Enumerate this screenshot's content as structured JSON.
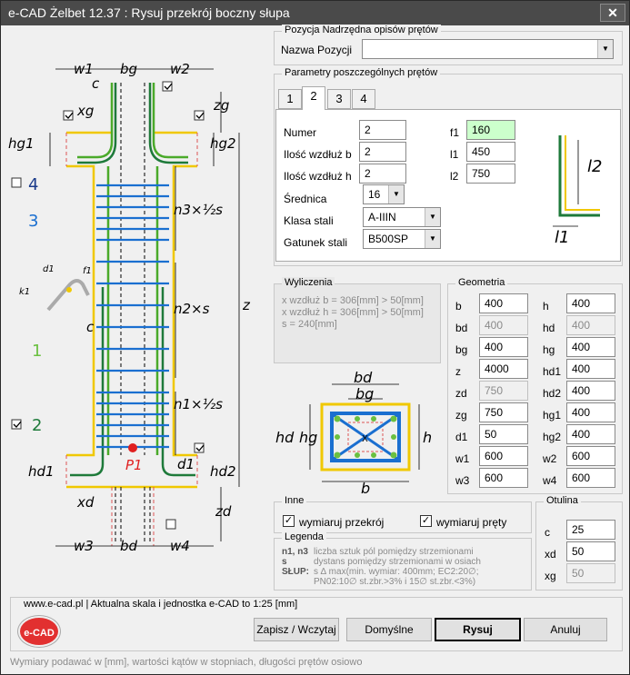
{
  "window": {
    "title": "e-CAD Żelbet 12.37 : Rysuj przekrój boczny słupa",
    "close_glyph": "✕"
  },
  "top_group": {
    "title": "Pozycja Nadrzędna opisów prętów",
    "name_label": "Nazwa Pozycji",
    "name_value": ""
  },
  "params_group": {
    "title": "Parametry poszczególnych prętów"
  },
  "tabs": [
    "1",
    "2",
    "3",
    "4"
  ],
  "active_tab": 1,
  "bar_params": {
    "numer_label": "Numer",
    "numer": "2",
    "ilosc_b_label": "Ilość wzdłuż b",
    "ilosc_b": "2",
    "ilosc_h_label": "Ilość wzdłuż h",
    "ilosc_h": "2",
    "srednica_label": "Średnica",
    "srednica": "16",
    "klasa_label": "Klasa stali",
    "klasa": "A-IIIN",
    "gatunek_label": "Gatunek stali",
    "gatunek": "B500SP",
    "f1_label": "f1",
    "f1": "160",
    "l1_label": "l1",
    "l1": "450",
    "l2_label": "l2",
    "l2": "750"
  },
  "bar_sketch": {
    "l1": "l1",
    "l2": "l2"
  },
  "calc_group": {
    "title": "Wyliczenia",
    "lines": [
      "x wzdłuż b = 306[mm] > 50[mm]",
      "x wzdłuż h = 306[mm] > 50[mm]",
      "s = 240[mm]"
    ]
  },
  "geometry_group": {
    "title": "Geometria",
    "left": [
      {
        "label": "b",
        "value": "400",
        "disabled": false
      },
      {
        "label": "bd",
        "value": "400",
        "disabled": true
      },
      {
        "label": "bg",
        "value": "400",
        "disabled": false
      },
      {
        "label": "z",
        "value": "4000",
        "disabled": false
      },
      {
        "label": "zd",
        "value": "750",
        "disabled": true
      },
      {
        "label": "zg",
        "value": "750",
        "disabled": false
      },
      {
        "label": "d1",
        "value": "50",
        "disabled": false
      },
      {
        "label": "w1",
        "value": "600",
        "disabled": false
      },
      {
        "label": "w3",
        "value": "600",
        "disabled": false
      }
    ],
    "right": [
      {
        "label": "h",
        "value": "400",
        "disabled": false
      },
      {
        "label": "hd",
        "value": "400",
        "disabled": true
      },
      {
        "label": "hg",
        "value": "400",
        "disabled": false
      },
      {
        "label": "hd1",
        "value": "400",
        "disabled": false
      },
      {
        "label": "hd2",
        "value": "400",
        "disabled": false
      },
      {
        "label": "hg1",
        "value": "400",
        "disabled": false
      },
      {
        "label": "hg2",
        "value": "400",
        "disabled": false
      },
      {
        "label": "w2",
        "value": "600",
        "disabled": false
      },
      {
        "label": "w4",
        "value": "600",
        "disabled": false
      }
    ]
  },
  "section_sketch": {
    "bd": "bd",
    "bg": "bg",
    "hd": "hd",
    "hg": "hg",
    "h": "h",
    "b": "b",
    "x": "X"
  },
  "inne_group": {
    "title": "Inne",
    "chk1": "wymiaruj przekrój",
    "chk2": "wymiaruj pręty",
    "chk1_checked": true,
    "chk2_checked": true
  },
  "otulina_group": {
    "title": "Otulina",
    "c_label": "c",
    "c": "25",
    "xd_label": "xd",
    "xd": "50",
    "xg_label": "xg",
    "xg": "50"
  },
  "legend_group": {
    "title": "Legenda",
    "rows": [
      {
        "key": "n1, n3",
        "text": "liczba sztuk pól pomiędzy strzemionami"
      },
      {
        "key": "s",
        "text": "dystans pomiędzy strzemionami w osiach"
      },
      {
        "key": "SŁUP:",
        "text": "s ∆ max(min. wymiar: 400mm; EC2:20∅;"
      },
      {
        "key": "",
        "text": "PN02:10∅ st.zbr.>3% i 15∅ st.zbr.<3%)"
      }
    ]
  },
  "footer": {
    "info": "www.e-cad.pl | Aktualna skala i jednostka e-CAD to 1:25 [mm]",
    "logo": "e-CAD",
    "status": "Wymiary podawać w [mm], wartości kątów w stopniach, długości prętów osiowo"
  },
  "buttons": {
    "save": "Zapisz / Wczytaj",
    "default": "Domyślne",
    "draw": "Rysuj",
    "cancel": "Anuluj"
  },
  "drawing": {
    "w1": "w1",
    "bg": "bg",
    "w2": "w2",
    "c_top": "c",
    "zg": "zg",
    "xg": "xg",
    "hg1": "hg1",
    "hg2": "hg2",
    "bar4": "4",
    "bar3": "3",
    "n3": "n3×½s",
    "d1": "d1",
    "f1": "f1",
    "k1": "k1",
    "c_mid": "c",
    "n2": "n2×s",
    "z": "z",
    "bar1": "1",
    "n1": "n1×½s",
    "bar2": "2",
    "p1": "P1",
    "hd1": "hd1",
    "d1b": "d1",
    "hd2": "hd2",
    "xd": "xd",
    "zd": "zd",
    "w3": "w3",
    "bd": "bd",
    "w4": "w4"
  }
}
